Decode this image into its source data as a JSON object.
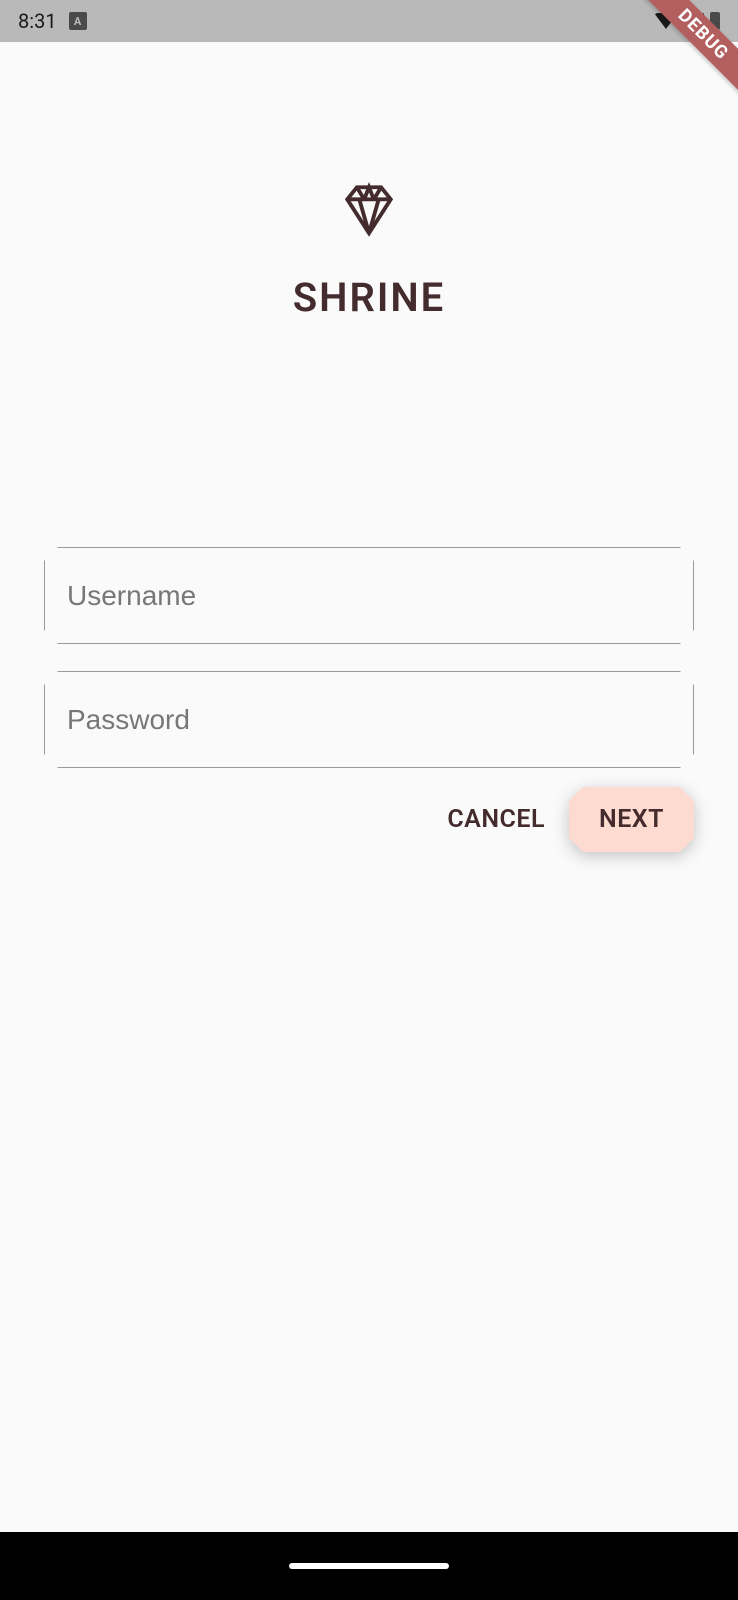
{
  "status_bar": {
    "time": "8:31",
    "indicator": "A"
  },
  "debug_banner": "DEBUG",
  "logo": {
    "title": "SHRINE"
  },
  "form": {
    "username_placeholder": "Username",
    "username_value": "",
    "password_placeholder": "Password",
    "password_value": ""
  },
  "buttons": {
    "cancel_label": "CANCEL",
    "next_label": "NEXT"
  },
  "colors": {
    "brand_text": "#442B2D",
    "button_bg": "#FEDBD0",
    "app_bg": "#fafafa",
    "status_bar_bg": "#b9b9b9",
    "debug_banner_bg": "#b45f5f"
  }
}
